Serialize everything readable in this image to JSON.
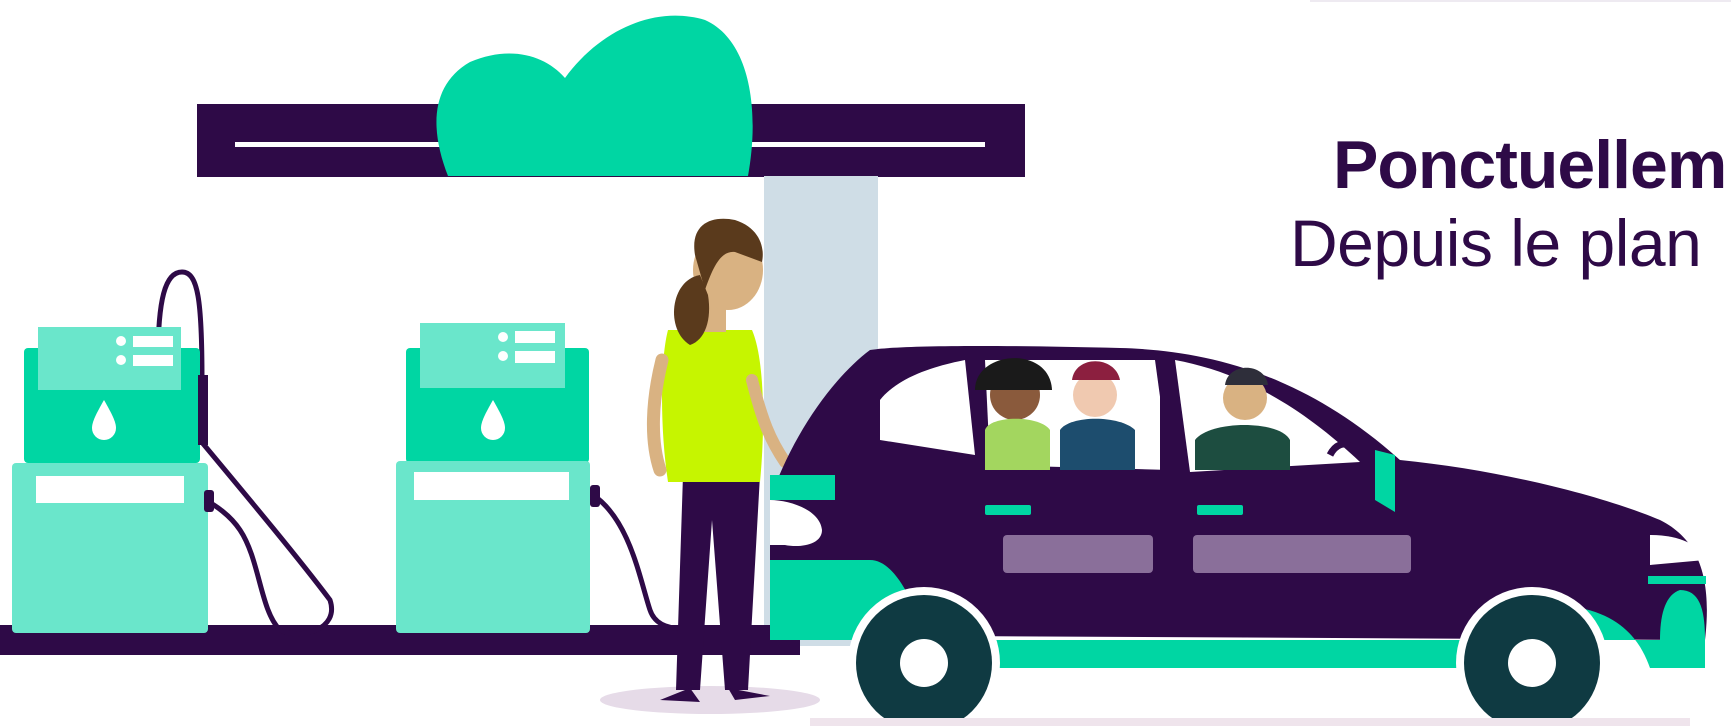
{
  "hero": {
    "title_bold": "Ponctuellem",
    "title_light": "Depuis le plan"
  },
  "illustration": {
    "description_icon": "car-fueling-at-station-illustration",
    "colors": {
      "brand_dark": "#2e0a47",
      "brand_green": "#00d6a3",
      "pump_light": "#6ae6cb",
      "shirt_yellow": "#c6f500",
      "window_panel": "#8a6f9a",
      "pillar": "#cfdde6"
    }
  }
}
